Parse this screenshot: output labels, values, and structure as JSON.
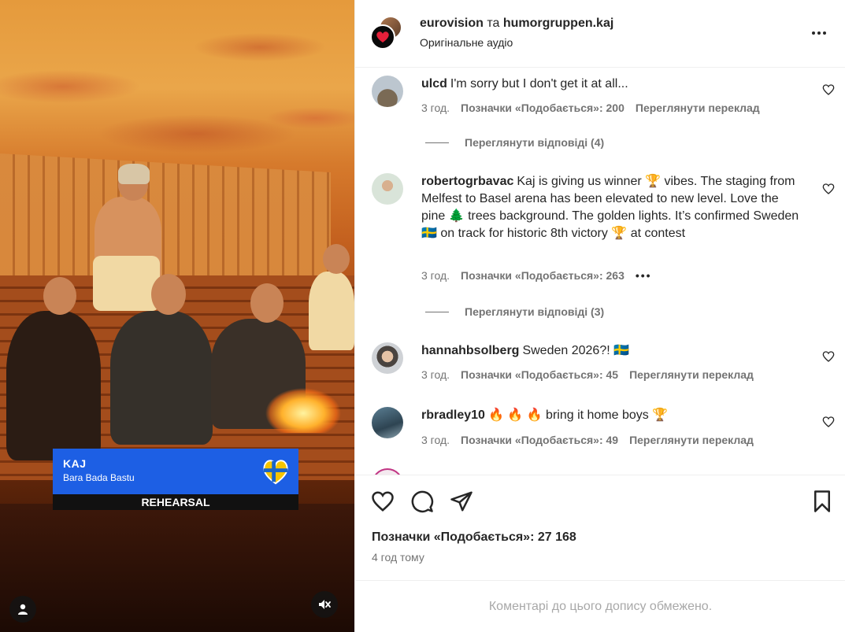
{
  "video": {
    "lower_third_artist": "KAJ",
    "lower_third_song": "Bara Bada Bastu",
    "lower_third_label": "REHEARSAL",
    "colors": {
      "lower_third": "#1d5fe4"
    }
  },
  "header": {
    "account_primary": "eurovision",
    "joiner": " та ",
    "account_secondary": "humorgruppen.kaj",
    "audio": "Оригінальне аудіо"
  },
  "comments": [
    {
      "user": "ulcd",
      "text": "I'm sorry but I don't get it at all...",
      "time": "3 год.",
      "likes": "Позначки «Подобається»: 200",
      "action": "Переглянути переклад",
      "replies": "Переглянути відповіді (4)"
    },
    {
      "user": "robertogrbavac",
      "text": "Kaj is giving us winner 🏆 vibes. The staging from Melfest to Basel arena has been elevated to new level. Love the pine 🌲 trees background. The golden lights. It’s confirmed Sweden 🇸🇪 on track for historic 8th victory 🏆 at contest",
      "time": "3 год.",
      "likes": "Позначки «Подобається»: 263",
      "action": "•••",
      "replies": "Переглянути відповіді (3)"
    },
    {
      "user": "hannahbsolberg",
      "text": "Sweden 2026?! 🇸🇪",
      "time": "3 год.",
      "likes": "Позначки «Подобається»: 45",
      "action": "Переглянути переклад"
    },
    {
      "user": "rbradley10",
      "text": "🔥 🔥 🔥 bring it home boys 🏆",
      "time": "3 год.",
      "likes": "Позначки «Подобається»: 49",
      "action": "Переглянути переклад"
    }
  ],
  "footer": {
    "likes": "Позначки «Подобається»: 27 168",
    "posted": "4 год тому",
    "restricted": "Коментарі до цього допису обмежено."
  },
  "icons": {
    "like": "heart-icon",
    "comment": "comment-icon",
    "share": "paper-plane-icon",
    "save": "bookmark-icon",
    "more": "more-options-icon",
    "mute": "mute-icon",
    "user_tag": "user-tag-icon"
  }
}
